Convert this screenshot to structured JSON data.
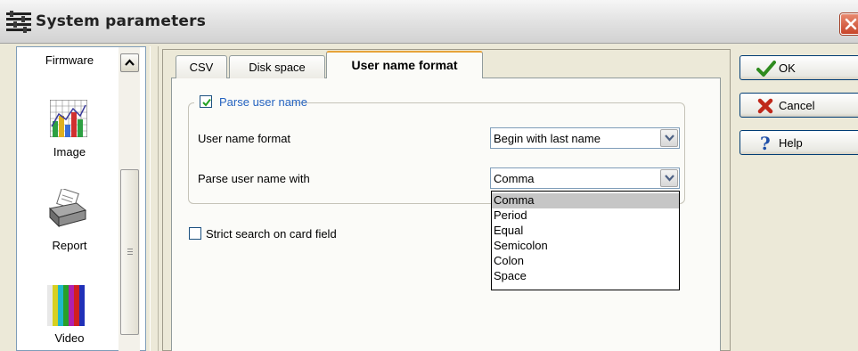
{
  "window": {
    "title": "System parameters",
    "icon": "system-parameters-icon",
    "close_icon": "close-x-icon"
  },
  "sidebar": {
    "items": [
      {
        "label": "Firmware",
        "icon": "firmware-icon"
      },
      {
        "label": "Image",
        "icon": "bar-chart-icon"
      },
      {
        "label": "Report",
        "icon": "printer-icon"
      },
      {
        "label": "Video",
        "icon": "color-bars-icon"
      }
    ]
  },
  "tabs": [
    {
      "label": "CSV",
      "active": false
    },
    {
      "label": "Disk space",
      "active": false
    },
    {
      "label": "User name format",
      "active": true
    }
  ],
  "parse_group": {
    "checkbox_label": "Parse user name",
    "checked": true,
    "format_label": "User name format",
    "format_value": "Begin with last name",
    "parse_with_label": "Parse user name with",
    "parse_with_value": "Comma"
  },
  "dropdown": {
    "options": [
      "Comma",
      "Period",
      "Equal",
      "Semicolon",
      "Colon",
      "Space"
    ],
    "selected": "Comma"
  },
  "strict_search": {
    "label": "Strict search on card field",
    "checked": false
  },
  "buttons": {
    "ok": {
      "label": "OK",
      "icon": "checkmark-icon",
      "color": "#2e8b1e"
    },
    "cancel": {
      "label": "Cancel",
      "icon": "red-x-icon",
      "color": "#c0281a"
    },
    "help": {
      "label": "Help",
      "icon": "question-mark-icon",
      "color": "#1f4fa8"
    }
  },
  "colors": {
    "accent_tab": "#e6a33a",
    "title_close": "#c8452a",
    "checkbox_label": "#2563c0"
  }
}
